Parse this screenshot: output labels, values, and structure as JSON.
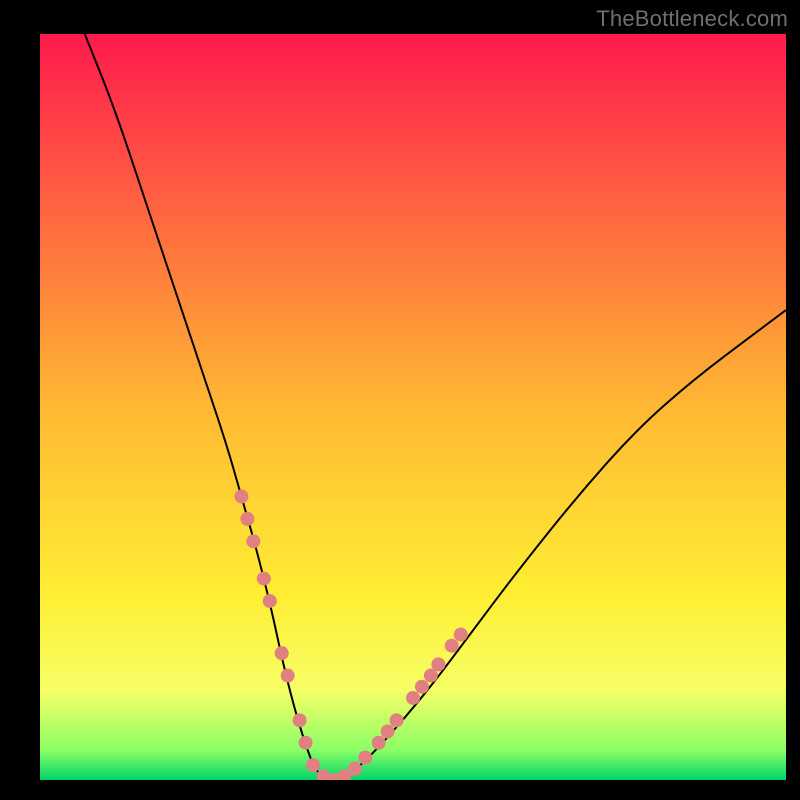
{
  "watermark": "TheBottleneck.com",
  "chart_data": {
    "type": "line",
    "title": "",
    "xlabel": "",
    "ylabel": "",
    "xlim": [
      0,
      100
    ],
    "ylim": [
      0,
      100
    ],
    "grid": false,
    "legend": false,
    "background_gradient": {
      "stops": [
        {
          "offset": 0.0,
          "color": "#ff1a4d"
        },
        {
          "offset": 0.5,
          "color": "#ffb833"
        },
        {
          "offset": 0.75,
          "color": "#ffee33"
        },
        {
          "offset": 0.88,
          "color": "#f6ff66"
        },
        {
          "offset": 0.96,
          "color": "#8cff66"
        },
        {
          "offset": 1.0,
          "color": "#00d46a"
        }
      ]
    },
    "series": [
      {
        "name": "bottleneck-curve",
        "stroke": "#000000",
        "x": [
          6,
          10,
          14,
          18,
          22,
          25,
          27,
          29,
          31,
          32.5,
          34,
          35.5,
          37,
          39,
          42,
          46,
          52,
          58,
          64,
          72,
          80,
          88,
          96,
          100
        ],
        "y": [
          100,
          90,
          78,
          66,
          54,
          45,
          38,
          31,
          23,
          16,
          10,
          5,
          1,
          0,
          1,
          5,
          12,
          20,
          28,
          38,
          47,
          54,
          60,
          63
        ]
      },
      {
        "name": "highlight-dots",
        "stroke": "none",
        "marker_color": "#e08080",
        "marker_radius": 7,
        "points": [
          {
            "x": 27.0,
            "y": 38
          },
          {
            "x": 27.8,
            "y": 35
          },
          {
            "x": 28.6,
            "y": 32
          },
          {
            "x": 30.0,
            "y": 27
          },
          {
            "x": 30.8,
            "y": 24
          },
          {
            "x": 32.4,
            "y": 17
          },
          {
            "x": 33.2,
            "y": 14
          },
          {
            "x": 34.8,
            "y": 8
          },
          {
            "x": 35.6,
            "y": 5
          },
          {
            "x": 36.6,
            "y": 2
          },
          {
            "x": 38.0,
            "y": 0.5
          },
          {
            "x": 39.4,
            "y": 0
          },
          {
            "x": 40.8,
            "y": 0.5
          },
          {
            "x": 42.2,
            "y": 1.5
          },
          {
            "x": 43.6,
            "y": 3
          },
          {
            "x": 45.4,
            "y": 5
          },
          {
            "x": 46.6,
            "y": 6.5
          },
          {
            "x": 47.8,
            "y": 8
          },
          {
            "x": 50.0,
            "y": 11
          },
          {
            "x": 51.2,
            "y": 12.5
          },
          {
            "x": 52.4,
            "y": 14
          },
          {
            "x": 53.4,
            "y": 15.5
          },
          {
            "x": 55.2,
            "y": 18
          },
          {
            "x": 56.4,
            "y": 19.5
          }
        ]
      }
    ]
  }
}
